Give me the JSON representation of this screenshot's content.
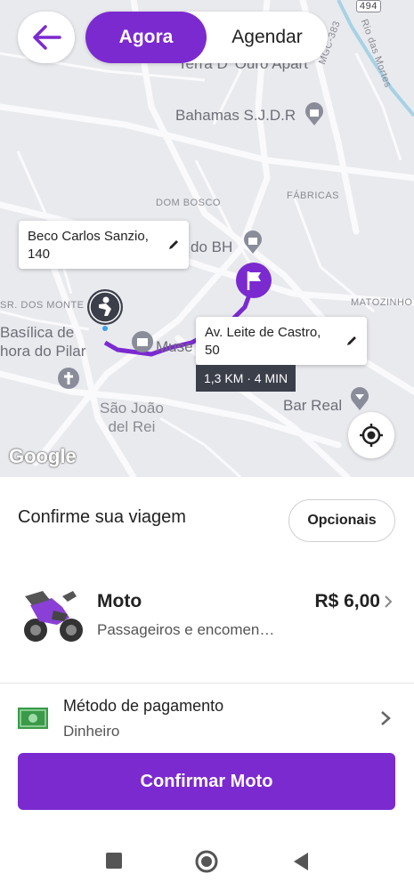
{
  "header": {
    "tab_now": "Agora",
    "tab_schedule": "Agendar"
  },
  "map": {
    "places": {
      "terra": "Terra D' Ouro Apart",
      "bahamas": "Bahamas S.J.D.R",
      "dom_bosco": "DOM BOSCO",
      "fabricas": "FÁBRICAS",
      "do_bh": "do BH",
      "sr_dos_monte": "SR. DOS MONTE",
      "matozinho": "MATOZINHO",
      "basilica_1": "Basílica de",
      "basilica_2": "hora do Pilar",
      "museu": "Muse",
      "sao_joao_1": "São João",
      "sao_joao_2": "del Rei",
      "bar_real": "Bar Real",
      "road_mgc": "MGC-383",
      "rio": "Rio das Mortes",
      "road_494": "494"
    },
    "pickup_address": "Beco Carlos Sanzio, 140",
    "dropoff_address": "Av. Leite de Castro, 50",
    "route_info": "1,3 KM · 4 MIN",
    "attribution": "Google"
  },
  "sheet": {
    "title": "Confirme sua viagem",
    "options_label": "Opcionais",
    "ride": {
      "name": "Moto",
      "description": "Passageiros e encomen…",
      "price": "R$ 6,00"
    },
    "payment": {
      "label": "Método de pagamento",
      "value": "Dinheiro"
    },
    "confirm_label": "Confirmar Moto"
  },
  "colors": {
    "accent": "#7b2ad0",
    "map_bg": "#e9eaee",
    "money_green": "#3a9a4a"
  },
  "icons": {
    "back": "arrow-left-icon",
    "edit": "pencil-icon",
    "flag": "flag-icon",
    "person": "person-icon",
    "locate": "crosshair-icon",
    "moto": "motorcycle-icon",
    "money": "money-bill-icon",
    "chevron": "chevron-right-icon",
    "nav_recent": "square-icon",
    "nav_home": "circle-icon",
    "nav_back": "triangle-icon"
  }
}
